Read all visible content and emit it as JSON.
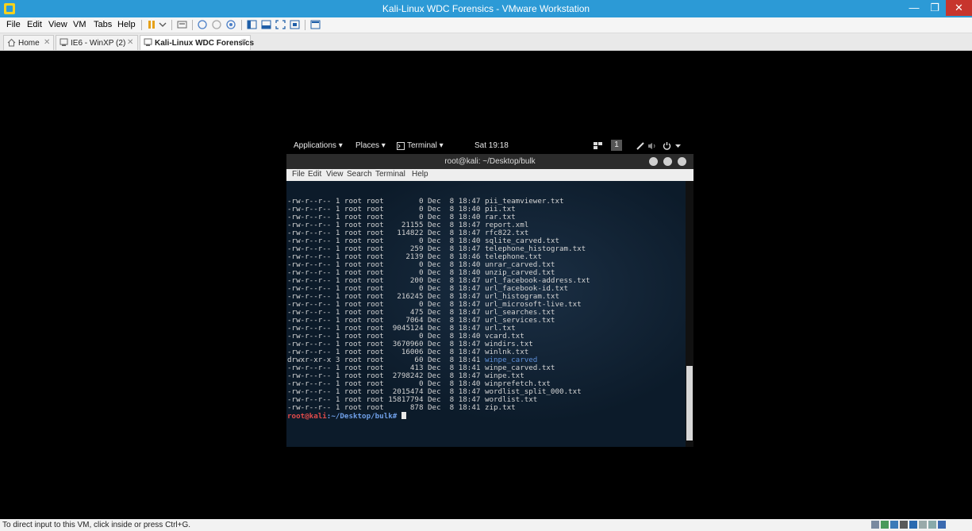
{
  "window": {
    "title": "Kali-Linux WDC Forensics - VMware Workstation",
    "minimize": "—",
    "maximize": "❐",
    "close": "✕"
  },
  "menubar": [
    "File",
    "Edit",
    "View",
    "VM",
    "Tabs",
    "Help"
  ],
  "tabs": [
    {
      "label": "Home",
      "active": false
    },
    {
      "label": "IE6 - WinXP (2)",
      "active": false
    },
    {
      "label": "Kali-Linux WDC Forensics",
      "active": true
    }
  ],
  "gnome_panel": {
    "applications": "Applications ▾",
    "places": "Places ▾",
    "terminal": "Terminal ▾",
    "clock": "Sat 19:18",
    "workspace": "1"
  },
  "terminal": {
    "title": "root@kali: ~/Desktop/bulk",
    "menu": [
      "File",
      "Edit",
      "View",
      "Search",
      "Terminal",
      "Help"
    ],
    "lines": [
      {
        "perm": "-rw-r--r--",
        "meta": " 1 root root        0 Dec  8 18:47 ",
        "name": "pii_teamviewer.txt"
      },
      {
        "perm": "-rw-r--r--",
        "meta": " 1 root root        0 Dec  8 18:40 ",
        "name": "pii.txt"
      },
      {
        "perm": "-rw-r--r--",
        "meta": " 1 root root        0 Dec  8 18:40 ",
        "name": "rar.txt"
      },
      {
        "perm": "-rw-r--r--",
        "meta": " 1 root root    21155 Dec  8 18:47 ",
        "name": "report.xml"
      },
      {
        "perm": "-rw-r--r--",
        "meta": " 1 root root   114822 Dec  8 18:47 ",
        "name": "rfc822.txt"
      },
      {
        "perm": "-rw-r--r--",
        "meta": " 1 root root        0 Dec  8 18:40 ",
        "name": "sqlite_carved.txt"
      },
      {
        "perm": "-rw-r--r--",
        "meta": " 1 root root      259 Dec  8 18:47 ",
        "name": "telephone_histogram.txt"
      },
      {
        "perm": "-rw-r--r--",
        "meta": " 1 root root     2139 Dec  8 18:46 ",
        "name": "telephone.txt"
      },
      {
        "perm": "-rw-r--r--",
        "meta": " 1 root root        0 Dec  8 18:40 ",
        "name": "unrar_carved.txt"
      },
      {
        "perm": "-rw-r--r--",
        "meta": " 1 root root        0 Dec  8 18:40 ",
        "name": "unzip_carved.txt"
      },
      {
        "perm": "-rw-r--r--",
        "meta": " 1 root root      200 Dec  8 18:47 ",
        "name": "url_facebook-address.txt"
      },
      {
        "perm": "-rw-r--r--",
        "meta": " 1 root root        0 Dec  8 18:47 ",
        "name": "url_facebook-id.txt"
      },
      {
        "perm": "-rw-r--r--",
        "meta": " 1 root root   216245 Dec  8 18:47 ",
        "name": "url_histogram.txt"
      },
      {
        "perm": "-rw-r--r--",
        "meta": " 1 root root        0 Dec  8 18:47 ",
        "name": "url_microsoft-live.txt"
      },
      {
        "perm": "-rw-r--r--",
        "meta": " 1 root root      475 Dec  8 18:47 ",
        "name": "url_searches.txt"
      },
      {
        "perm": "-rw-r--r--",
        "meta": " 1 root root     7064 Dec  8 18:47 ",
        "name": "url_services.txt"
      },
      {
        "perm": "-rw-r--r--",
        "meta": " 1 root root  9045124 Dec  8 18:47 ",
        "name": "url.txt"
      },
      {
        "perm": "-rw-r--r--",
        "meta": " 1 root root        0 Dec  8 18:40 ",
        "name": "vcard.txt"
      },
      {
        "perm": "-rw-r--r--",
        "meta": " 1 root root  3670960 Dec  8 18:47 ",
        "name": "windirs.txt"
      },
      {
        "perm": "-rw-r--r--",
        "meta": " 1 root root    16006 Dec  8 18:47 ",
        "name": "winlnk.txt"
      },
      {
        "perm": "drwxr-xr-x",
        "meta": " 3 root root       60 Dec  8 18:41 ",
        "name": "winpe_carved",
        "dir": true
      },
      {
        "perm": "-rw-r--r--",
        "meta": " 1 root root      413 Dec  8 18:41 ",
        "name": "winpe_carved.txt"
      },
      {
        "perm": "-rw-r--r--",
        "meta": " 1 root root  2798242 Dec  8 18:47 ",
        "name": "winpe.txt"
      },
      {
        "perm": "-rw-r--r--",
        "meta": " 1 root root        0 Dec  8 18:40 ",
        "name": "winprefetch.txt"
      },
      {
        "perm": "-rw-r--r--",
        "meta": " 1 root root  2015474 Dec  8 18:47 ",
        "name": "wordlist_split_000.txt"
      },
      {
        "perm": "-rw-r--r--",
        "meta": " 1 root root 15817794 Dec  8 18:47 ",
        "name": "wordlist.txt"
      },
      {
        "perm": "-rw-r--r--",
        "meta": " 1 root root      878 Dec  8 18:41 ",
        "name": "zip.txt"
      }
    ],
    "prompt_user": "root@kali",
    "prompt_path": ":~/Desktop/bulk#",
    "scroll_position": 0.92
  },
  "status": {
    "message": "To direct input to this VM, click inside or press Ctrl+G."
  },
  "colors": {
    "titlebar": "#2c9ad6",
    "close": "#c7352d",
    "terminal_bg": "#0c1b2a",
    "prompt_user": "#e24b4b",
    "prompt_path": "#6f9fe8",
    "directory": "#5d8fd8"
  },
  "icons": [
    "vmware-app-icon",
    "pause-icon",
    "snapshot-icon",
    "home-tab-icon",
    "vm-tab-icon",
    "workspace-icon",
    "network-icon",
    "volume-icon",
    "power-icon"
  ]
}
